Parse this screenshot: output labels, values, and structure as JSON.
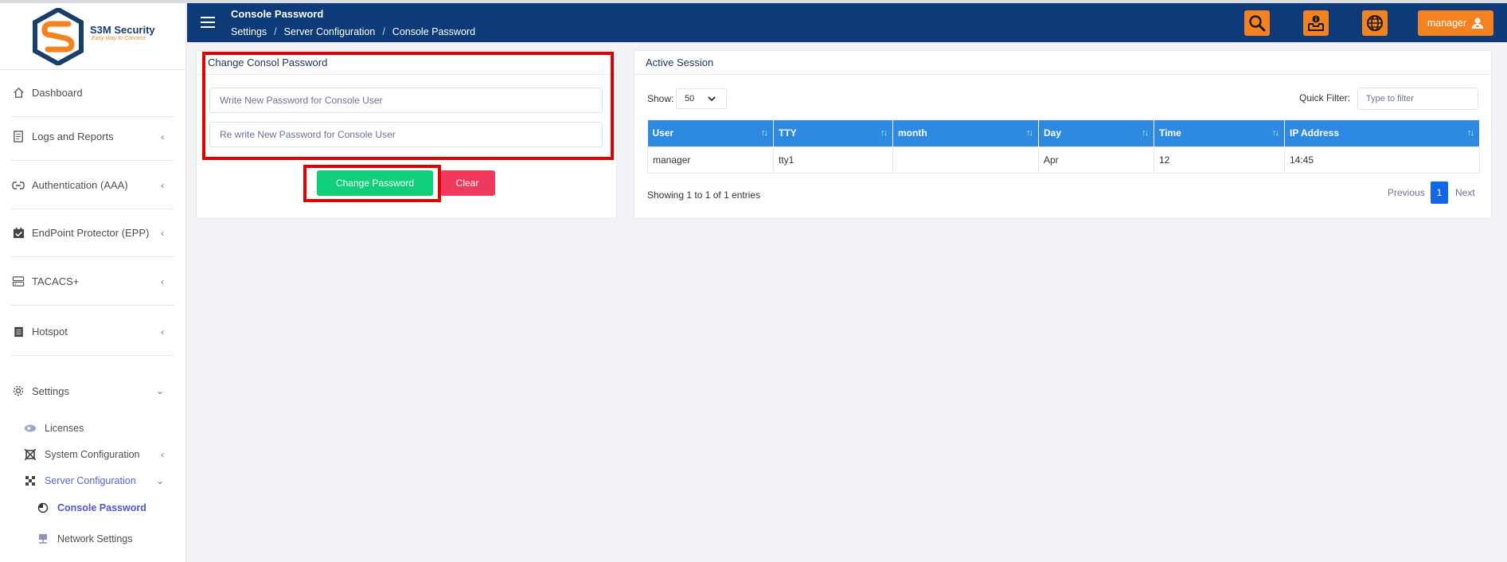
{
  "brand": {
    "name": "S3M Security",
    "tagline": "Easy Way to Connect"
  },
  "header": {
    "page_title": "Console Password",
    "breadcrumb": [
      "Settings",
      "Server Configuration",
      "Console Password"
    ],
    "user_label": "manager",
    "accent_color": "#f58220",
    "bar_color": "#0d3a78"
  },
  "sidebar": {
    "items": [
      {
        "label": "Dashboard",
        "icon": "home-icon"
      },
      {
        "label": "Logs and Reports",
        "icon": "document-icon"
      },
      {
        "label": "Authentication (AAA)",
        "icon": "link-icon"
      },
      {
        "label": "EndPoint Protector (EPP)",
        "icon": "calendar-check-icon"
      },
      {
        "label": "TACACS+",
        "icon": "server-icon"
      },
      {
        "label": "Hotspot",
        "icon": "list-icon"
      },
      {
        "label": "Settings",
        "icon": "gear-icon"
      }
    ],
    "settings_sub": [
      {
        "label": "Licenses",
        "icon": "license-icon"
      },
      {
        "label": "System Configuration",
        "icon": "system-icon"
      },
      {
        "label": "Server Configuration",
        "icon": "server-config-icon"
      }
    ],
    "server_sub": [
      {
        "label": "Console Password",
        "icon": "radio-icon"
      },
      {
        "label": "Network Settings",
        "icon": "network-icon"
      }
    ]
  },
  "password_panel": {
    "title": "Change Consol Password",
    "new_password_placeholder": "Write New Password for Console User",
    "confirm_password_placeholder": "Re write New Password for Console User",
    "submit_label": "Change Password",
    "clear_label": "Clear"
  },
  "session_panel": {
    "title": "Active Session",
    "show_label": "Show:",
    "page_size": "50",
    "filter_label": "Quick Filter:",
    "filter_placeholder": "Type to filter",
    "columns": [
      "User",
      "TTY",
      "month",
      "Day",
      "Time",
      "IP Address"
    ],
    "rows": [
      [
        "manager",
        "tty1",
        "",
        "Apr",
        "12",
        "14:45"
      ]
    ],
    "info": "Showing 1 to 1 of 1 entries",
    "pagination": {
      "previous": "Previous",
      "current": "1",
      "next": "Next"
    }
  }
}
